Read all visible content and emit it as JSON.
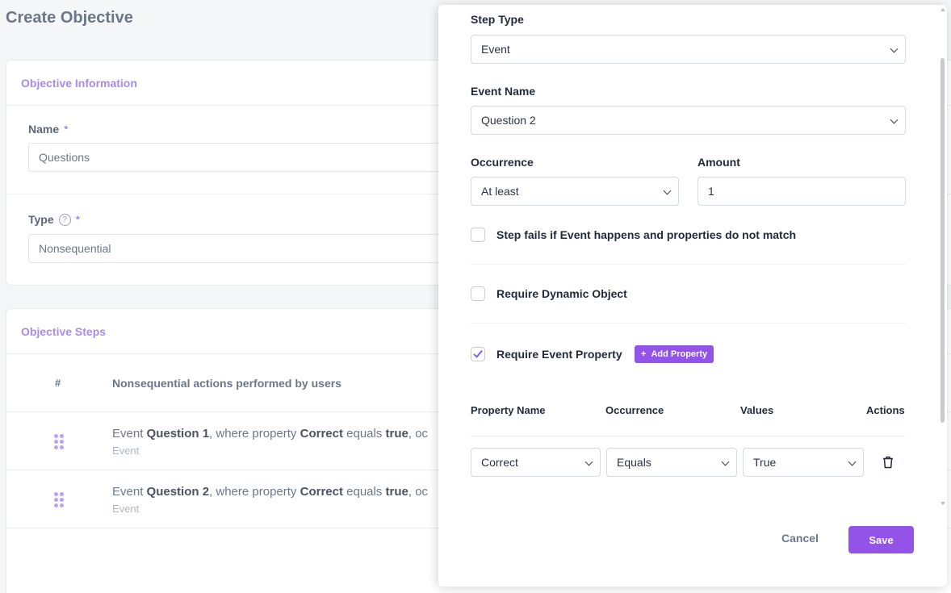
{
  "page": {
    "title": "Create Objective"
  },
  "objective_info": {
    "header": "Objective Information",
    "name_label": "Name",
    "name_required": "*",
    "name_value": "Questions",
    "type_label": "Type",
    "type_help": "?",
    "type_required": "*",
    "type_value": "Nonsequential"
  },
  "objective_steps": {
    "header": "Objective Steps",
    "col_hash": "#",
    "col_actions": "Nonsequential actions performed by users",
    "rows": [
      {
        "prefix": "Event ",
        "event": "Question 1",
        "mid": ", where property ",
        "property": "Correct",
        "op": " equals ",
        "value": "true",
        "suffix": ", oc",
        "sub": "Event"
      },
      {
        "prefix": "Event ",
        "event": "Question 2",
        "mid": ", where property ",
        "property": "Correct",
        "op": " equals ",
        "value": "true",
        "suffix": ", oc",
        "sub": "Event"
      }
    ]
  },
  "modal": {
    "step_type_label": "Step Type",
    "step_type_value": "Event",
    "event_name_label": "Event Name",
    "event_name_value": "Question 2",
    "occurrence_label": "Occurrence",
    "occurrence_value": "At least",
    "amount_label": "Amount",
    "amount_value": "1",
    "step_fails_label": "Step fails if Event happens and properties do not match",
    "step_fails_checked": false,
    "require_dynamic_label": "Require Dynamic Object",
    "require_dynamic_checked": false,
    "require_event_property_label": "Require Event Property",
    "require_event_property_checked": true,
    "add_property_label": "Add Property",
    "add_property_icon": "+",
    "table_headers": {
      "property_name": "Property Name",
      "occurrence": "Occurrence",
      "values": "Values",
      "actions": "Actions"
    },
    "property_row": {
      "property_name": "Correct",
      "occurrence": "Equals",
      "value": "True"
    },
    "cancel_label": "Cancel",
    "save_label": "Save"
  },
  "colors": {
    "accent": "#9353e8",
    "header_purple": "#a78be6"
  }
}
